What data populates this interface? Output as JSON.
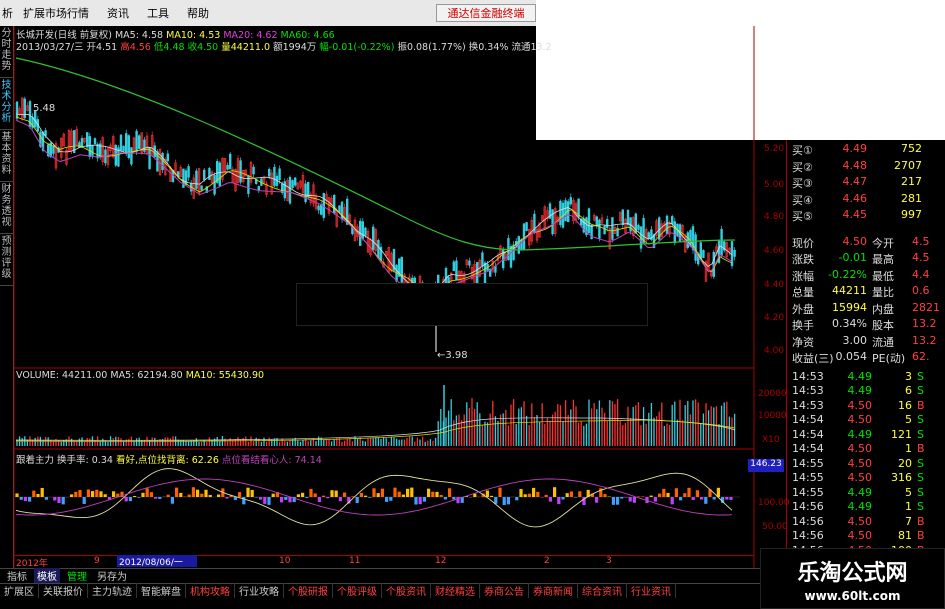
{
  "menu": {
    "items": [
      "析",
      "扩展市场行情",
      "资讯",
      "工具",
      "帮助"
    ],
    "brand": "通达信金融终端"
  },
  "leftnav": [
    "分时走势",
    "技术分析",
    "基本资料",
    "财务透视",
    "预测评级"
  ],
  "header": {
    "title": "长城开发(日线 前复权)",
    "ma5": "MA5: 4.58",
    "ma10": "MA10: 4.53",
    "ma20": "MA20: 4.62",
    "ma60": "MA60: 4.66",
    "info_date": "2013/03/27/三",
    "info_open": "开4.51",
    "info_high": "高4.56",
    "info_low": "低4.48",
    "info_close": "收4.50",
    "info_vol": "量44211.0",
    "info_amt": "额1994万",
    "info_chg": "幅-0.01(-0.22%)",
    "info_amp": "振0.08(1.77%)",
    "info_turn": "换0.34%",
    "info_float": "流通13.2"
  },
  "kline": {
    "hi_label": "5.48",
    "lo_label": "←3.98",
    "axis": [
      "5.20",
      "5.00",
      "4.80",
      "4.60",
      "4.40",
      "4.20",
      "4.00"
    ]
  },
  "volume": {
    "label": "VOLUME: 44211.00",
    "ma5": "MA5: 62194.80",
    "ma10": "MA10: 55430.90",
    "axis": [
      "20000",
      "10000",
      "X10"
    ]
  },
  "indicator": {
    "name": "跟着主力",
    "turn": "换手率: 0.34",
    "good": "看好,点位找背离: 62.26",
    "point": "点位看结看心人: 74.14",
    "axis": [
      "146.23",
      "100.00",
      "50.00"
    ]
  },
  "dates": {
    "items": [
      "2012年",
      "9",
      "10",
      "11",
      "12",
      "2",
      "3"
    ],
    "selected": "2012/08/06/一"
  },
  "tabs": [
    "指标",
    "模板",
    "管理",
    "另存为"
  ],
  "footer": [
    "扩展区",
    "关联报价",
    "主力轨迹",
    "智能解盘",
    "机构攻略",
    "行业攻略",
    "个股研报",
    "个股评级",
    "个股资讯",
    "财经精选",
    "券商公告",
    "券商新闻",
    "综合资讯",
    "行业资讯"
  ],
  "quote": {
    "buy": [
      {
        "l": "买①",
        "p": "4.49",
        "v": "752"
      },
      {
        "l": "买②",
        "p": "4.48",
        "v": "2707"
      },
      {
        "l": "买③",
        "p": "4.47",
        "v": "217"
      },
      {
        "l": "买④",
        "p": "4.46",
        "v": "281"
      },
      {
        "l": "买⑤",
        "p": "4.45",
        "v": "997"
      }
    ],
    "stats": [
      {
        "a": "现价",
        "b": "4.50",
        "c": "今开",
        "d": "4.5"
      },
      {
        "a": "涨跌",
        "b": "-0.01",
        "c": "最高",
        "d": "4.5"
      },
      {
        "a": "涨幅",
        "b": "-0.22%",
        "c": "最低",
        "d": "4.4"
      },
      {
        "a": "总量",
        "b": "44211",
        "c": "量比",
        "d": "0.6"
      },
      {
        "a": "外盘",
        "b": "15994",
        "c": "内盘",
        "d": "2821"
      },
      {
        "a": "换手",
        "b": "0.34%",
        "c": "股本",
        "d": "13.2"
      },
      {
        "a": "净资",
        "b": "3.00",
        "c": "流通",
        "d": "13.2"
      },
      {
        "a": "收益(三)",
        "b": "0.054",
        "c": "PE(动)",
        "d": "62."
      }
    ],
    "ticks": [
      {
        "t": "14:53",
        "p": "4.49",
        "v": "3",
        "s": "S"
      },
      {
        "t": "14:53",
        "p": "4.49",
        "v": "6",
        "s": "S"
      },
      {
        "t": "14:53",
        "p": "4.50",
        "v": "16",
        "s": "B"
      },
      {
        "t": "14:54",
        "p": "4.50",
        "v": "5",
        "s": "S"
      },
      {
        "t": "14:54",
        "p": "4.49",
        "v": "121",
        "s": "S"
      },
      {
        "t": "14:54",
        "p": "4.50",
        "v": "1",
        "s": "B"
      },
      {
        "t": "14:55",
        "p": "4.50",
        "v": "20",
        "s": "S"
      },
      {
        "t": "14:55",
        "p": "4.50",
        "v": "316",
        "s": "S"
      },
      {
        "t": "14:55",
        "p": "4.49",
        "v": "5",
        "s": "S"
      },
      {
        "t": "14:56",
        "p": "4.49",
        "v": "1",
        "s": "S"
      },
      {
        "t": "14:56",
        "p": "4.50",
        "v": "7",
        "s": "B"
      },
      {
        "t": "14:56",
        "p": "4.50",
        "v": "81",
        "s": "B"
      },
      {
        "t": "14:56",
        "p": "4.50",
        "v": "100",
        "s": "B"
      }
    ]
  },
  "watermark": {
    "cn": "乐淘公式网",
    "url": "www.60lt.com"
  },
  "colors": {
    "up": "#ff3030",
    "down": "#30d0e0",
    "ma5": "#e0e0e0",
    "ma10": "#e0e000",
    "ma20": "#c040c0",
    "ma60": "#30c030"
  }
}
